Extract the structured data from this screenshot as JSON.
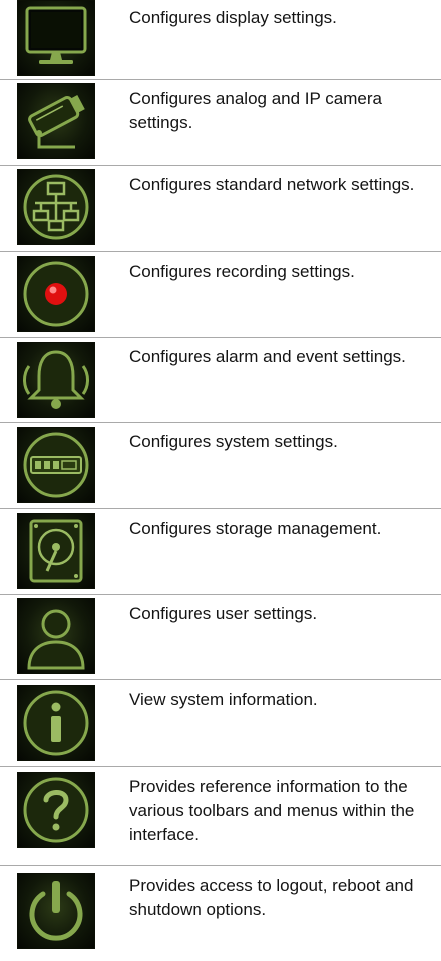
{
  "menu_items": [
    {
      "icon": "monitor-icon",
      "description": "Configures display settings."
    },
    {
      "icon": "camera-icon",
      "description": "Configures analog and IP camera settings."
    },
    {
      "icon": "network-icon",
      "description": "Configures standard network settings."
    },
    {
      "icon": "record-icon",
      "description": "Configures recording settings."
    },
    {
      "icon": "alarm-bell-icon",
      "description": "Configures alarm and event settings."
    },
    {
      "icon": "system-icon",
      "description": "Configures system settings."
    },
    {
      "icon": "storage-hdd-icon",
      "description": "Configures storage management."
    },
    {
      "icon": "user-icon",
      "description": "Configures user settings."
    },
    {
      "icon": "info-icon",
      "description": "View system information."
    },
    {
      "icon": "help-icon",
      "description": "Provides reference information to the various toolbars and menus within the interface."
    },
    {
      "icon": "power-icon",
      "description": "Provides access to logout, reboot and shutdown options."
    }
  ],
  "colors": {
    "icon_green": "#8fb35a",
    "record_red": "#e01010",
    "separator": "#a9a9a9"
  }
}
